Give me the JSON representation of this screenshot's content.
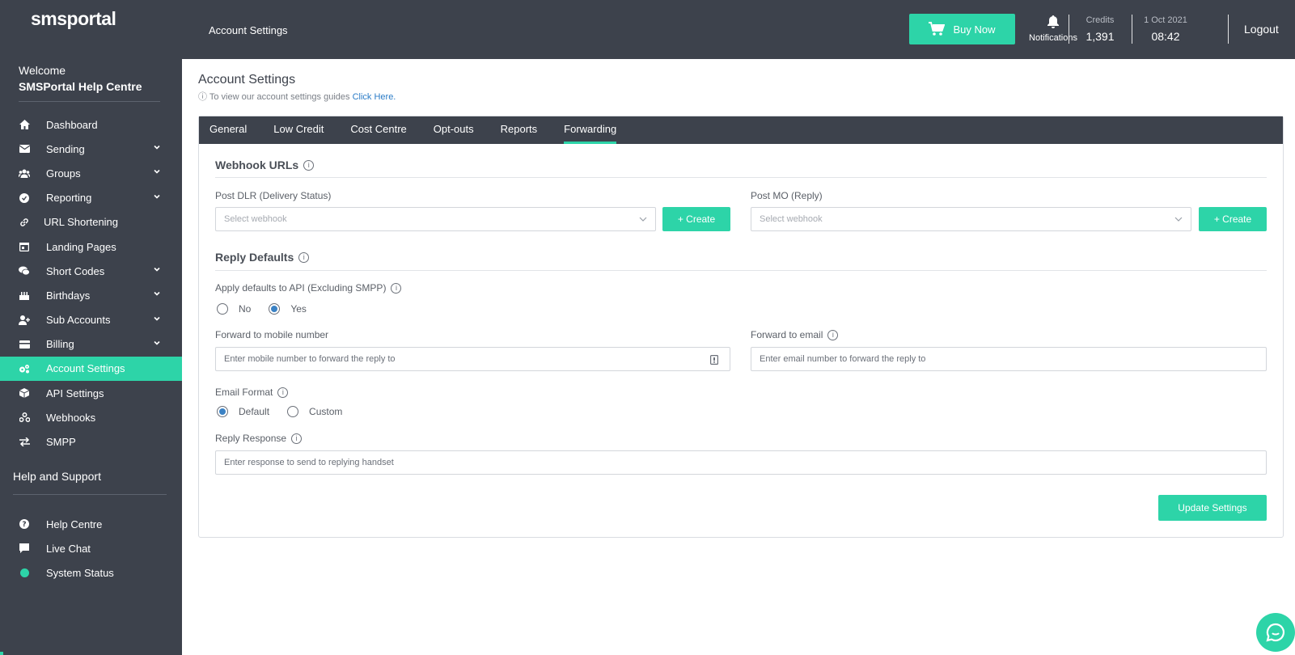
{
  "brand": {
    "logo_text": "smsportal",
    "accent": "#2dd4a8",
    "dark": "#3d424c"
  },
  "sidebar": {
    "welcome": "Welcome",
    "account_name": "SMSPortal Help Centre",
    "items": [
      {
        "label": "Dashboard",
        "icon": "home-icon",
        "has_chevron": false
      },
      {
        "label": "Sending",
        "icon": "envelope-icon",
        "has_chevron": true
      },
      {
        "label": "Groups",
        "icon": "users-icon",
        "has_chevron": true
      },
      {
        "label": "Reporting",
        "icon": "reporting-icon",
        "has_chevron": true
      },
      {
        "label": "URL Shortening",
        "icon": "link-icon",
        "has_chevron": false
      },
      {
        "label": "Landing Pages",
        "icon": "page-icon",
        "has_chevron": false
      },
      {
        "label": "Short Codes",
        "icon": "chat-icon",
        "has_chevron": true
      },
      {
        "label": "Birthdays",
        "icon": "cake-icon",
        "has_chevron": true
      },
      {
        "label": "Sub Accounts",
        "icon": "user-plus-icon",
        "has_chevron": true
      },
      {
        "label": "Billing",
        "icon": "credit-card-icon",
        "has_chevron": true
      },
      {
        "label": "Account Settings",
        "icon": "gears-icon",
        "has_chevron": false
      },
      {
        "label": "API Settings",
        "icon": "cube-icon",
        "has_chevron": false
      },
      {
        "label": "Webhooks",
        "icon": "webhook-icon",
        "has_chevron": false
      },
      {
        "label": "SMPP",
        "icon": "exchange-icon",
        "has_chevron": false
      }
    ],
    "help_title": "Help and Support",
    "help_items": [
      {
        "label": "Help Centre",
        "icon": "question-icon"
      },
      {
        "label": "Live Chat",
        "icon": "comment-icon"
      },
      {
        "label": "System Status",
        "icon": "status-dot-icon"
      }
    ]
  },
  "topbar": {
    "title": "Account Settings",
    "buy_now": "Buy Now",
    "notifications": "Notifications",
    "credits_label": "Credits",
    "credits_value": "1,391",
    "date": "1 Oct 2021",
    "time": "08:42",
    "logout": "Logout"
  },
  "main": {
    "title": "Account Settings",
    "guide_text": "To view our account settings guides",
    "guide_link": "Click Here.",
    "tabs": [
      "General",
      "Low Credit",
      "Cost Centre",
      "Opt-outs",
      "Reports",
      "Forwarding"
    ],
    "active_tab": "Forwarding",
    "webhook_section": "Webhook URLs",
    "post_dlr_label": "Post DLR (Delivery Status)",
    "post_mo_label": "Post MO (Reply)",
    "select_placeholder": "Select webhook",
    "create_label": "+ Create",
    "reply_section": "Reply Defaults",
    "apply_defaults_label": "Apply defaults to API (Excluding SMPP)",
    "no_label": "No",
    "yes_label": "Yes",
    "forward_mobile_label": "Forward to mobile number",
    "forward_mobile_placeholder": "Enter mobile number to forward the reply to",
    "forward_email_label": "Forward to email",
    "forward_email_placeholder": "Enter email number to forward the reply to",
    "email_format_label": "Email Format",
    "default_label": "Default",
    "custom_label": "Custom",
    "reply_response_label": "Reply Response",
    "reply_response_placeholder": "Enter response to send to replying handset",
    "update_button": "Update Settings"
  }
}
